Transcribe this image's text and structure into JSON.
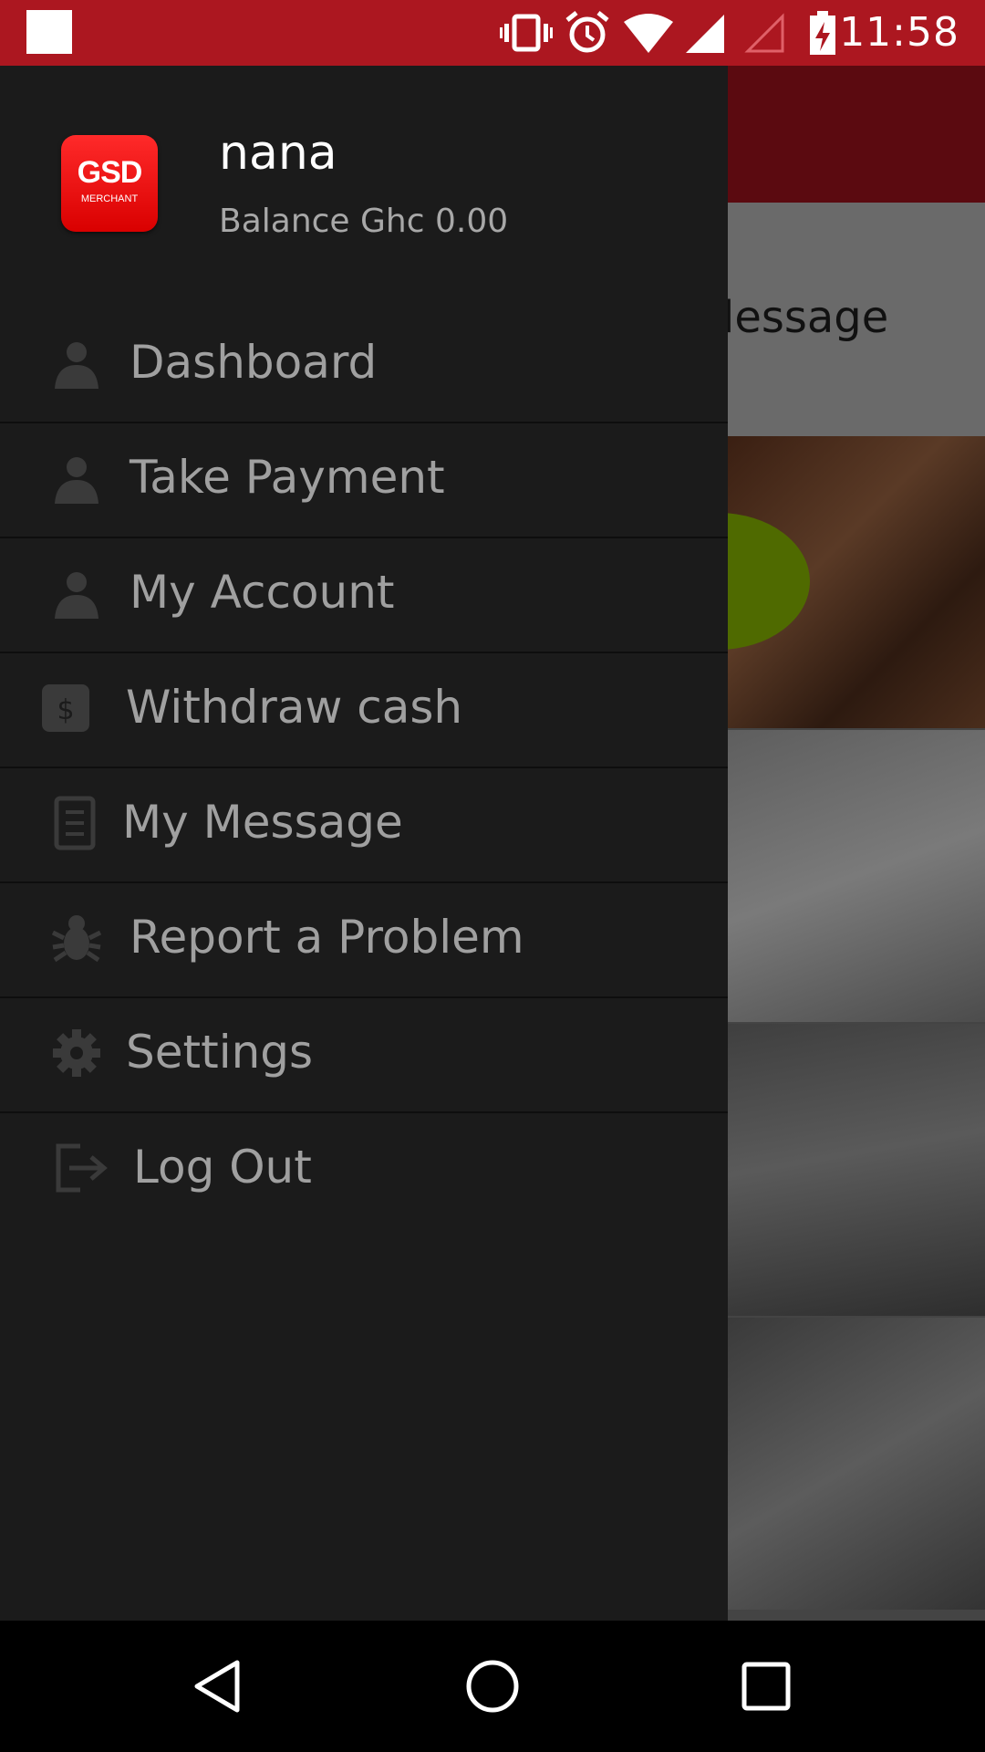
{
  "status_bar": {
    "time": "11:58"
  },
  "background": {
    "card_text": "lessage"
  },
  "drawer": {
    "logo": {
      "main": "GSD",
      "sub": "MERCHANT"
    },
    "user": {
      "name": "nana",
      "balance": "Balance Ghc 0.00"
    },
    "menu": [
      {
        "label": "Dashboard",
        "icon": "person-icon"
      },
      {
        "label": "Take Payment",
        "icon": "person-icon"
      },
      {
        "label": "My Account",
        "icon": "person-icon"
      },
      {
        "label": "Withdraw cash",
        "icon": "dollar-icon"
      },
      {
        "label": "My Message",
        "icon": "document-icon"
      },
      {
        "label": "Report a Problem",
        "icon": "bug-icon"
      },
      {
        "label": "Settings",
        "icon": "gear-icon"
      },
      {
        "label": "Log Out",
        "icon": "logout-icon"
      }
    ]
  },
  "colors": {
    "status_bar": "#ac1720",
    "drawer_bg": "#1b1b1b",
    "menu_text": "#a0a0a0"
  }
}
